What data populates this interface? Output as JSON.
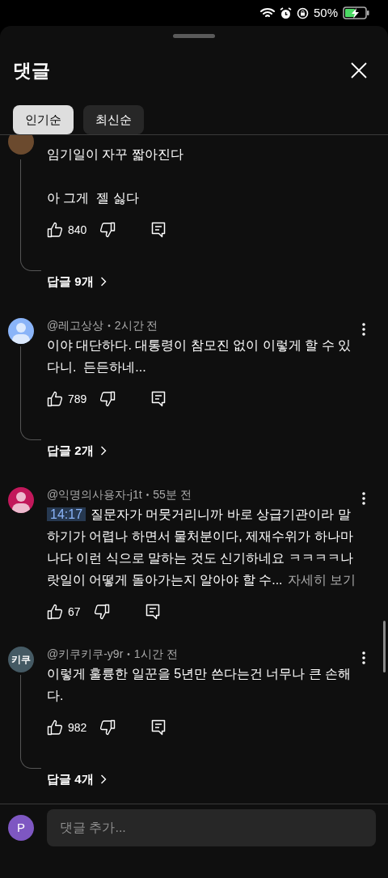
{
  "status_bar": {
    "battery": "50%"
  },
  "sheet": {
    "title": "댓글"
  },
  "tabs": [
    {
      "label": "인기순",
      "selected": true
    },
    {
      "label": "최신순",
      "selected": false
    }
  ],
  "comments": [
    {
      "avatar": {
        "kind": "photo",
        "color": "#6b4a2e"
      },
      "paragraphs": [
        "임기일이 자꾸 짧아진다",
        "아 그게  젤 싫다"
      ],
      "likes": "840",
      "replies": "답글 9개"
    },
    {
      "avatar": {
        "kind": "person",
        "color": "#8ab4f8"
      },
      "author": "@레고상상",
      "separator": "•",
      "time": "2시간 전",
      "paragraphs": [
        "이야 대단하다. 대통령이 참모진 없이 이렇게 할 수 있다니.  든든하네..."
      ],
      "likes": "789",
      "replies": "답글 2개"
    },
    {
      "avatar": {
        "kind": "person",
        "color": "#c2185b"
      },
      "author": "@익명의사용자-j1t",
      "separator": "•",
      "time": "55분 전",
      "timestamp": "14:17",
      "paragraphs": [
        "질문자가 머뭇거리니까 바로 상급기관이라 말하기가 어렵나 하면서 물처분이다, 제재수위가 하나마나다 이런 식으로 말하는 것도 신기하네요 ㅋㅋㅋㅋ나랏일이 어떻게 돌아가는지 알아야 할 수..."
      ],
      "more": "자세히 보기",
      "likes": "67"
    },
    {
      "avatar": {
        "kind": "text",
        "text": "키쿠",
        "color": "#455a64"
      },
      "author": "@키쿠키쿠-y9r",
      "separator": "•",
      "time": "1시간 전",
      "paragraphs": [
        "이렇게 훌륭한 일꾼을 5년만 쓴다는건 너무나 큰 손해다."
      ],
      "likes": "982",
      "replies": "답글 4개"
    }
  ],
  "composer": {
    "avatar": {
      "text": "P"
    },
    "placeholder": "댓글 추가..."
  }
}
